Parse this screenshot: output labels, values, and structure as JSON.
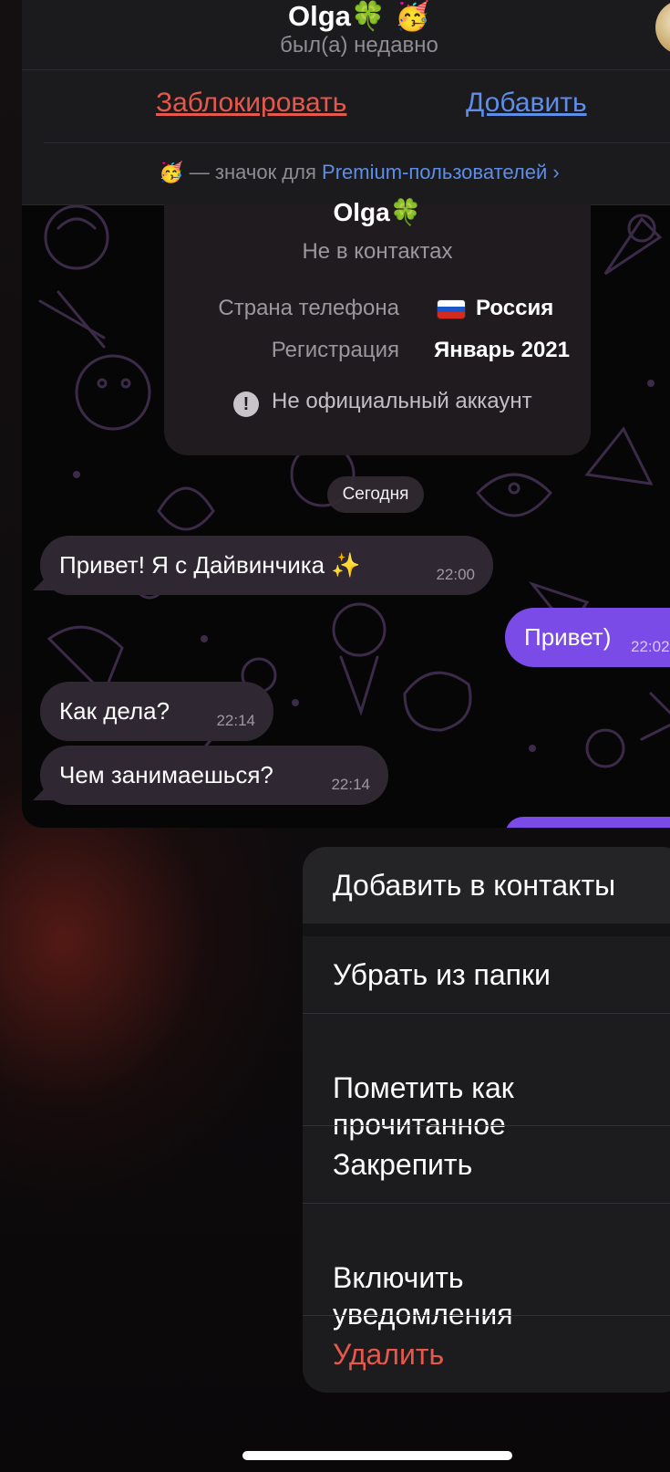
{
  "chat_header": {
    "name": "Olga",
    "name_emojis": "🍀 🥳",
    "status": "был(а) недавно",
    "block_label": "Заблокировать",
    "add_label": "Добавить",
    "premium_prefix": " — значок для ",
    "premium_link": "Premium-пользователей",
    "premium_chevron": "›"
  },
  "info_card": {
    "name": "Olga",
    "name_emoji": "🍀",
    "status": "Не в контактах",
    "phone_country_label": "Страна телефона",
    "phone_country_value": "Россия",
    "registration_label": "Регистрация",
    "registration_value": "Январь 2021",
    "unofficial_note": "Не официальный аккаунт"
  },
  "date_chip": "Сегодня",
  "messages": [
    {
      "text": "Привет! Я с Дайвинчика ✨",
      "time": "22:00",
      "direction": "in"
    },
    {
      "text": "Привет)",
      "time": "22:02",
      "direction": "out"
    },
    {
      "text": "Как дела?",
      "time": "22:14",
      "direction": "in"
    },
    {
      "text": "Чем занимаешься?",
      "time": "22:14",
      "direction": "in"
    }
  ],
  "context_menu": [
    {
      "label": "Добавить в контакты",
      "icon": "add-contact-icon"
    },
    {
      "label": "Убрать из папки",
      "icon": "remove-folder-icon"
    },
    {
      "label": "Пометить как\nпрочитанное",
      "icon": "mark-read-icon"
    },
    {
      "label": "Закрепить",
      "icon": "pin-icon"
    },
    {
      "label": "Включить\nуведомления",
      "icon": "bell-icon"
    },
    {
      "label": "Удалить",
      "icon": "trash-icon"
    }
  ],
  "colors": {
    "accent_purple": "#7a4be6",
    "link_blue": "#5c8eea",
    "danger_red": "#e5584b"
  }
}
